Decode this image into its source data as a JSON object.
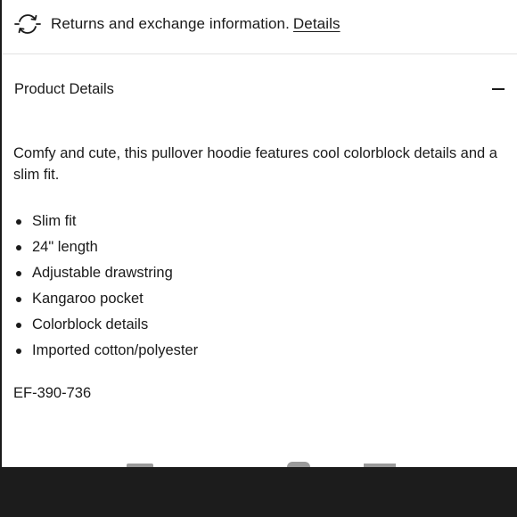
{
  "returns": {
    "icon": "exchange-arrows-icon",
    "text": "Returns and exchange information.",
    "link_label": "Details"
  },
  "accordion": {
    "title": "Product Details",
    "toggle_icon": "minus-icon",
    "expanded": true
  },
  "product": {
    "description": "Comfy and cute, this pullover hoodie features cool colorblock details and a slim fit.",
    "features": [
      "Slim fit",
      "24\" length",
      "Adjustable drawstring",
      "Kangaroo pocket",
      "Colorblock details",
      "Imported cotton/polyester"
    ],
    "sku": "EF-390-736"
  },
  "colors": {
    "text": "#1a1a1a",
    "bottom_bar": "#1c1c1c",
    "divider": "#e2e2e2"
  }
}
